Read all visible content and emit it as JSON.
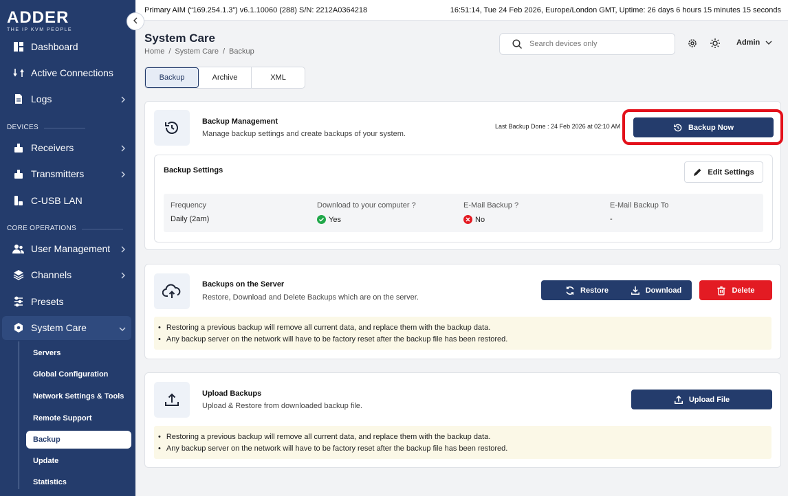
{
  "brand": {
    "name": "ADDER",
    "tagline": "THE IP KVM PEOPLE"
  },
  "topbar": {
    "system_info": "Primary AIM (“169.254.1.3”) v6.1.10060 (288) S/N: 2212A0364218",
    "clock": "16:51:14, Tue 24 Feb 2026, Europe/London GMT, Uptime: 26 days 6 hours 15 minutes 15 seconds"
  },
  "sidebar": {
    "items": [
      {
        "label": "Dashboard",
        "icon": "dashboard-icon"
      },
      {
        "label": "Active Connections",
        "icon": "connections-icon"
      },
      {
        "label": "Logs",
        "icon": "logs-icon"
      }
    ],
    "section_devices": "DEVICES",
    "devices": [
      {
        "label": "Receivers",
        "icon": "receiver-icon"
      },
      {
        "label": "Transmitters",
        "icon": "transmitter-icon"
      },
      {
        "label": "C-USB LAN",
        "icon": "usb-lan-icon"
      }
    ],
    "section_core": "CORE OPERATIONS",
    "core": [
      {
        "label": "User Management",
        "icon": "users-icon"
      },
      {
        "label": "Channels",
        "icon": "channels-icon"
      },
      {
        "label": "Presets",
        "icon": "presets-icon"
      },
      {
        "label": "System Care",
        "icon": "system-care-icon"
      }
    ],
    "system_care_sub": [
      "Servers",
      "Global Configuration",
      "Network Settings & Tools",
      "Remote Support",
      "Backup",
      "Update",
      "Statistics"
    ]
  },
  "header": {
    "title": "System Care",
    "breadcrumb": [
      "Home",
      "/",
      "System Care",
      "/",
      "Backup"
    ],
    "search_placeholder": "Search devices only",
    "user": "Admin"
  },
  "tabs": [
    "Backup",
    "Archive",
    "XML"
  ],
  "backup_management": {
    "title": "Backup Management",
    "desc": "Manage backup settings and create backups of your system.",
    "last_backup": "Last Backup Done : 24 Feb 2026 at 02:10 AM",
    "backup_now": "Backup Now",
    "settings_title": "Backup Settings",
    "edit_settings": "Edit Settings",
    "columns": [
      {
        "label": "Frequency",
        "value": "Daily (2am)",
        "status": ""
      },
      {
        "label": "Download to your computer ?",
        "value": "Yes",
        "status": "yes"
      },
      {
        "label": "E-Mail Backup ?",
        "value": "No",
        "status": "no"
      },
      {
        "label": "E-Mail Backup To",
        "value": "-",
        "status": ""
      }
    ]
  },
  "server_backups": {
    "title": "Backups on the Server",
    "desc": "Restore, Download and Delete Backups which are on the server.",
    "restore": "Restore",
    "download": "Download",
    "delete": "Delete",
    "notes": [
      "Restoring a previous backup will remove all current data, and replace them with the backup data.",
      "Any backup server on the network will have to be factory reset after the backup file has been restored."
    ]
  },
  "upload_backups": {
    "title": "Upload Backups",
    "desc": "Upload & Restore from downloaded backup file.",
    "upload": "Upload File",
    "notes": [
      "Restoring a previous backup will remove all current data, and replace them with the backup data.",
      "Any backup server on the network will have to be factory reset after the backup file has been restored."
    ]
  },
  "colors": {
    "primary": "#243c6c",
    "danger": "#e31b23",
    "success": "#21a84a",
    "notice": "#fbf8e7"
  }
}
